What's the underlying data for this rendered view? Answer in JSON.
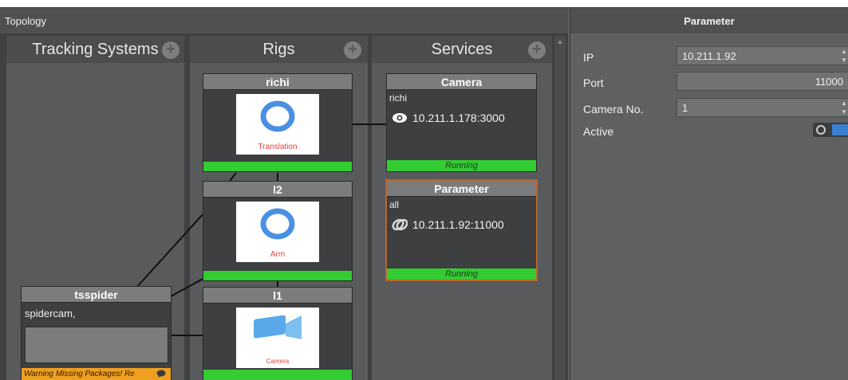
{
  "topology": {
    "title": "Topology",
    "columns": {
      "tracking_systems": {
        "label": "Tracking Systems",
        "add_icon": "plus-circle-icon"
      },
      "rigs": {
        "label": "Rigs",
        "add_icon": "plus-circle-icon"
      },
      "services": {
        "label": "Services",
        "add_icon": "plus-circle-icon"
      }
    },
    "rigs": [
      {
        "name": "richi",
        "caption": "Translation",
        "icon": "ring-icon"
      },
      {
        "name": "l2",
        "caption": "Arm",
        "icon": "ring-icon"
      },
      {
        "name": "l1",
        "caption": "Camera",
        "icon": "camera-icon"
      }
    ],
    "services": [
      {
        "name": "Camera",
        "owner": "richi",
        "address": "10.211.1.178:3000",
        "status": "Running",
        "icon": "eye-icon"
      },
      {
        "name": "Parameter",
        "owner": "all",
        "address": "10.211.1.92:11000",
        "status": "Running",
        "icon": "link-icon"
      }
    ],
    "tracking_systems": [
      {
        "name": "tsspider",
        "text": "spidercam,",
        "warning": "Warning Missing Packages! Re",
        "warning_icon": "chat-bubble-icon"
      }
    ]
  },
  "parameter_panel": {
    "title": "Parameter",
    "ip_label": "IP",
    "ip_value": "10.211.1.92",
    "port_label": "Port",
    "port_value": "11000",
    "camera_no_label": "Camera No.",
    "camera_no_value": "1",
    "active_label": "Active",
    "active_on": true
  },
  "colors": {
    "status_running": "#33cc33",
    "warning": "#f0a020",
    "selected_border": "#b8662a",
    "toggle_on": "#3a7fd0"
  }
}
